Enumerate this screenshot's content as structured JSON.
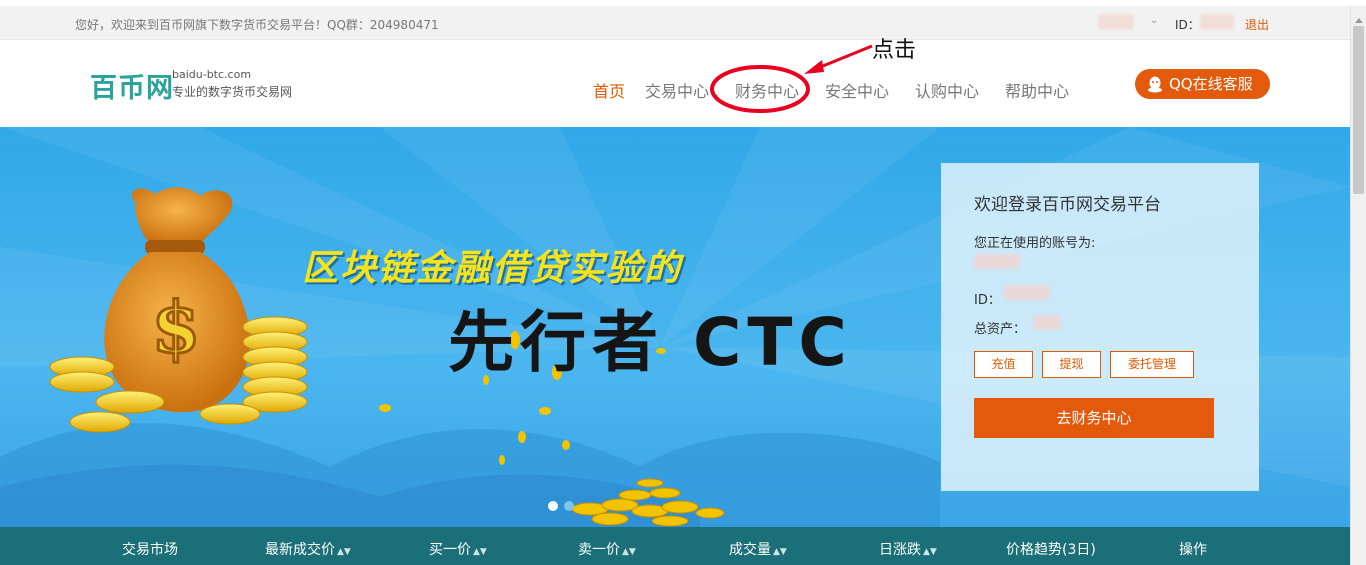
{
  "topbar": {
    "welcome": "您好，欢迎来到百币网旗下数字货币交易平台！QQ群：204980471",
    "id_label": "ID：",
    "logout": "退出"
  },
  "logo": {
    "mark": "百币网",
    "domain": "baidu-btc.com",
    "slogan": "专业的数字货币交易网"
  },
  "nav": {
    "home": "首页",
    "trade": "交易中心",
    "finance": "财务中心",
    "security": "安全中心",
    "subscribe": "认购中心",
    "help": "帮助中心"
  },
  "qq_service": "QQ在线客服",
  "annotation": "点击",
  "banner": {
    "headline1": "区块链金融借贷实验的",
    "headline2": "先行者 CTC"
  },
  "panel": {
    "title": "欢迎登录百币网交易平台",
    "account_label": "您正在使用的账号为:",
    "id_label": "ID：",
    "assets_label": "总资产：",
    "recharge": "充值",
    "withdraw": "提现",
    "orders": "委托管理",
    "go_finance": "去财务中心"
  },
  "table_header": {
    "market": "交易市场",
    "last_price": "最新成交价",
    "buy1": "买一价",
    "sell1": "卖一价",
    "volume": "成交量",
    "change": "日涨跌",
    "trend": "价格趋势(3日)",
    "action": "操作"
  },
  "colors": {
    "accent": "#e05a00",
    "brand": "#2aa39a",
    "banner": "#3aa9e8",
    "table_header": "#1a6f78",
    "annotation_red": "#e8001e"
  }
}
